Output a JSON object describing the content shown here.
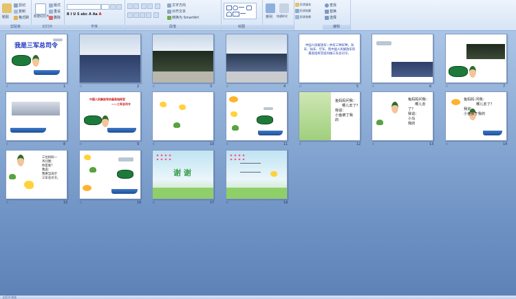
{
  "ribbon": {
    "groups": [
      {
        "label": "剪贴板",
        "items": [
          "粘贴",
          "剪切",
          "复制",
          "格式刷"
        ]
      },
      {
        "label": "幻灯片",
        "items": [
          "新建幻灯片",
          "版式",
          "重设",
          "删除"
        ]
      },
      {
        "label": "字体",
        "items": []
      },
      {
        "label": "段落",
        "items": [
          "文字方向",
          "对齐文本",
          "转换为 SmartArt"
        ]
      },
      {
        "label": "绘图",
        "items": []
      },
      {
        "label": "",
        "items": [
          "排列",
          "快速样式",
          "形状填充",
          "形状轮廓",
          "形状效果"
        ]
      },
      {
        "label": "编辑",
        "items": [
          "查找",
          "替换",
          "选择"
        ]
      }
    ]
  },
  "slides": [
    {
      "num": "1",
      "title": "我是三军总司令"
    },
    {
      "num": "2"
    },
    {
      "num": "3"
    },
    {
      "num": "4"
    },
    {
      "num": "5",
      "text": "中国人民解放军一共有三种军种，海军、陆军、空军，而中国人民解放军的最高指挥官就叫做三军总司令。"
    },
    {
      "num": "6"
    },
    {
      "num": "7"
    },
    {
      "num": "8"
    },
    {
      "num": "9",
      "title": "中国人民解放军的最高指挥官",
      "subtitle": "——三军总司令"
    },
    {
      "num": "10"
    },
    {
      "num": "11"
    },
    {
      "num": "12",
      "lines": [
        "鱼妈妈问我：",
        "哪儿去了？",
        "我说：",
        "小鱼被丁我",
        "的"
      ]
    },
    {
      "num": "13",
      "lines": [
        "龟妈妈问我：",
        "哪儿去",
        "了？",
        "我说：",
        "小鸟",
        "我的"
      ]
    },
    {
      "num": "14",
      "lines": [
        "鱼妈妈 问我：",
        "哪儿去了？",
        "我说：",
        "小鱼被丁我的"
      ]
    },
    {
      "num": "15",
      "lines": [
        "三位妈妈一",
        "齐问我：",
        "你是谁？",
        "我说：",
        "我要当海空",
        "三军总司令。"
      ]
    },
    {
      "num": "16"
    },
    {
      "num": "17",
      "title": "谢 谢"
    },
    {
      "num": "18"
    }
  ],
  "status": {
    "left": "幻灯片浏览"
  }
}
